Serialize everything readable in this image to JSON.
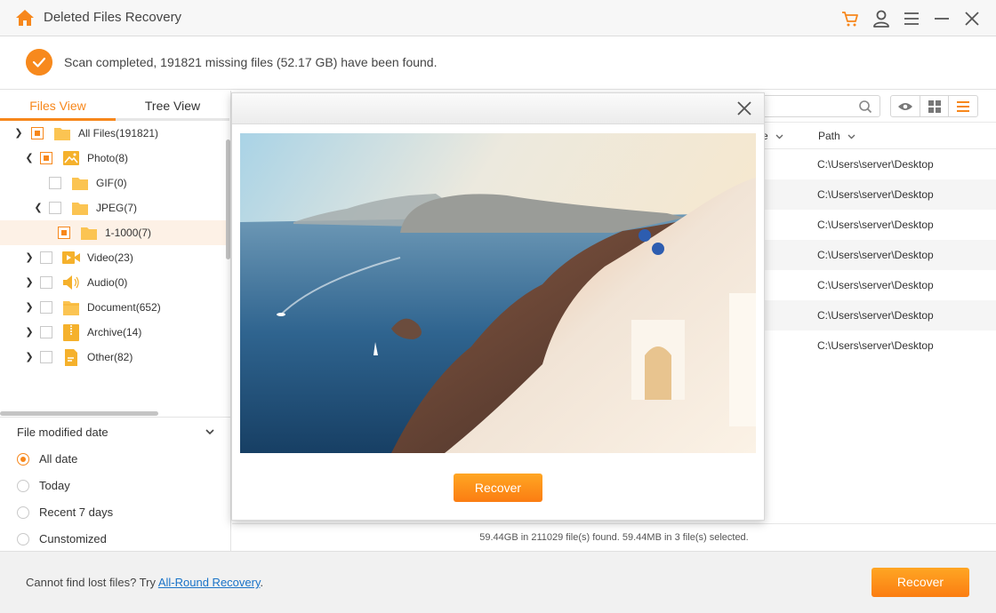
{
  "app": {
    "title": "Deleted Files Recovery",
    "icons": [
      "home-icon",
      "cart-icon",
      "user-icon",
      "menu-icon",
      "minimize-icon",
      "close-icon"
    ]
  },
  "banner": {
    "message": "Scan completed, 191821 missing files (52.17 GB) have been found.",
    "icon": "check-circle-icon"
  },
  "left_panel": {
    "tabs": [
      {
        "label": "Files View",
        "active": true
      },
      {
        "label": "Tree View",
        "active": false
      }
    ],
    "tree": [
      {
        "label": "All Files(191821)",
        "expander": "collapsed",
        "checked": "partial",
        "icon": "folder-icon",
        "level": 0
      },
      {
        "label": "Photo(8)",
        "expander": "expanded",
        "checked": "partial",
        "icon": "photo-icon",
        "level": 1
      },
      {
        "label": "GIF(0)",
        "expander": "none",
        "checked": "none",
        "icon": "folder-icon",
        "level": 2
      },
      {
        "label": "JPEG(7)",
        "expander": "expanded",
        "checked": "none",
        "icon": "folder-icon",
        "level": 2
      },
      {
        "label": "1-1000(7)",
        "expander": "none",
        "checked": "partial",
        "icon": "folder-icon",
        "level": 3,
        "selected": true
      },
      {
        "label": "Video(23)",
        "expander": "collapsed",
        "checked": "none",
        "icon": "video-icon",
        "level": 1
      },
      {
        "label": "Audio(0)",
        "expander": "collapsed",
        "checked": "none",
        "icon": "audio-icon",
        "level": 1
      },
      {
        "label": "Document(652)",
        "expander": "collapsed",
        "checked": "none",
        "icon": "document-icon",
        "level": 1
      },
      {
        "label": "Archive(14)",
        "expander": "collapsed",
        "checked": "none",
        "icon": "archive-icon",
        "level": 1
      },
      {
        "label": "Other(82)",
        "expander": "collapsed",
        "checked": "none",
        "icon": "other-file-icon",
        "level": 1
      }
    ],
    "filter": {
      "title": "File modified date",
      "options": [
        {
          "label": "All date",
          "selected": true
        },
        {
          "label": "Today",
          "selected": false
        },
        {
          "label": "Recent 7 days",
          "selected": false
        },
        {
          "label": "Cunstomized",
          "selected": false
        }
      ]
    }
  },
  "file_list": {
    "search_placeholder": "",
    "view_modes": [
      {
        "name": "preview",
        "active": false
      },
      {
        "name": "grid",
        "active": false
      },
      {
        "name": "list",
        "active": true
      }
    ],
    "columns": [
      {
        "label": "e",
        "sortable": true
      },
      {
        "label": "Path",
        "sortable": true
      }
    ],
    "rows": [
      {
        "path": "C:\\Users\\server\\Desktop"
      },
      {
        "path": "C:\\Users\\server\\Desktop"
      },
      {
        "path": "C:\\Users\\server\\Desktop"
      },
      {
        "path": "C:\\Users\\server\\Desktop"
      },
      {
        "path": "C:\\Users\\server\\Desktop"
      },
      {
        "path": "C:\\Users\\server\\Desktop"
      },
      {
        "path": "C:\\Users\\server\\Desktop"
      }
    ],
    "status": "59.44GB in 211029 file(s) found.  59.44MB in 3 file(s) selected."
  },
  "preview_modal": {
    "image_alt": "Santorini coastal village at sunset",
    "recover_label": "Recover"
  },
  "footer": {
    "hint_prefix": "Cannot find lost files? Try ",
    "hint_link": "All-Round Recovery",
    "hint_suffix": ".",
    "recover_label": "Recover"
  },
  "colors": {
    "accent": "#f7871b",
    "link": "#1a73c8",
    "folder": "#fbc452"
  }
}
